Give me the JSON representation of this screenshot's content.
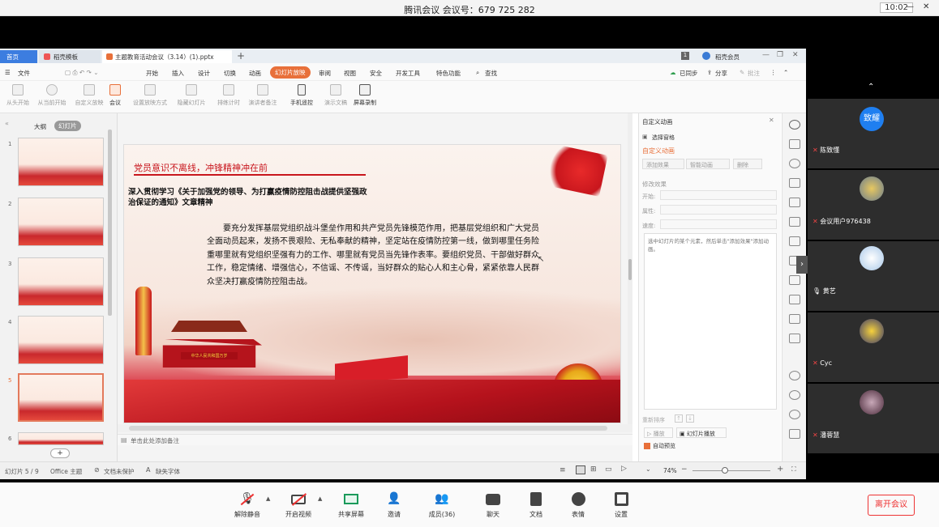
{
  "meeting": {
    "title": "腾讯会议 会议号：679 725 282",
    "time": "10:02"
  },
  "ppt": {
    "tabs": [
      "首页",
      "稻壳模板",
      "主题教育活动会议（3.14）(1).pptx"
    ],
    "file_menu": "文件",
    "menus": [
      "开始",
      "插入",
      "设计",
      "切换",
      "动画",
      "幻灯片放映",
      "审阅",
      "视图",
      "安全",
      "开发工具",
      "特色功能",
      "查找"
    ],
    "sync": "已同步",
    "share": "分享",
    "comment": "批注",
    "cloud": "稻壳会员",
    "tools": [
      "从头开始",
      "从当前开始",
      "自定义放映",
      "会议",
      "设置放映方式",
      "隐藏幻灯片",
      "排练计时",
      "演讲者备注",
      "手机遥控",
      "演示文稿",
      "屏幕录制"
    ],
    "view_tabs": [
      "大纲",
      "幻灯片"
    ],
    "slide_nums": [
      "1",
      "2",
      "3",
      "4",
      "5",
      "6"
    ],
    "slide": {
      "headline": "党员意识不离线，冲锋精神冲在前",
      "subtitle": "深入贯彻学习《关于加强党的领导、为打赢疫情防控阻击战提供坚强政治保证的通知》文章精神",
      "body": "要充分发挥基层党组织战斗堡垒作用和共产党员先锋模范作用，把基层党组织和广大党员全面动员起来，发扬不畏艰险、无私奉献的精神，坚定站在疫情防控第一线，做到哪里任务险重哪里就有党组织坚强有力的工作、哪里就有党员当先锋作表率。要组织党员、干部做好群众工作，稳定情绪、增强信心，不信谣、不传谣，当好群众的贴心人和主心骨，紧紧依靠人民群众坚决打赢疫情防控阻击战。",
      "banner": "中华人民共和国万岁"
    },
    "notes_hint": "单击此处添加备注",
    "animation_pane": {
      "title": "自定义动画",
      "select_window": "选择窗格",
      "section": "自定义动画",
      "add_effect": "添加效果",
      "smart_anim": "智能动画",
      "delete": "删除",
      "modify": "修改效果",
      "start": "开始:",
      "prop": "属性:",
      "speed": "速度:",
      "hint": "选中幻灯片的某个元素，然后单击\"添加效果\"添加动画。",
      "reorder": "重新排序",
      "play": "播放",
      "slideshow": "幻灯片播放",
      "autopreview": "自动预览"
    },
    "status": {
      "slide": "幻灯片 5 / 9",
      "theme": "Office 主题",
      "protect": "文档未保护",
      "fonts": "缺失字体",
      "zoom": "74%"
    }
  },
  "participants": [
    {
      "name": "陈致懂",
      "avatar_text": "致耀"
    },
    {
      "name": "会议用户976438"
    },
    {
      "name": "黄艺"
    },
    {
      "name": "Cyc"
    },
    {
      "name": "潘蓉慧"
    }
  ],
  "controls": [
    "解除静音",
    "开启视频",
    "共享屏幕",
    "邀请",
    "成员(36)",
    "聊天",
    "文档",
    "表情",
    "设置"
  ],
  "leave": "离开会议"
}
